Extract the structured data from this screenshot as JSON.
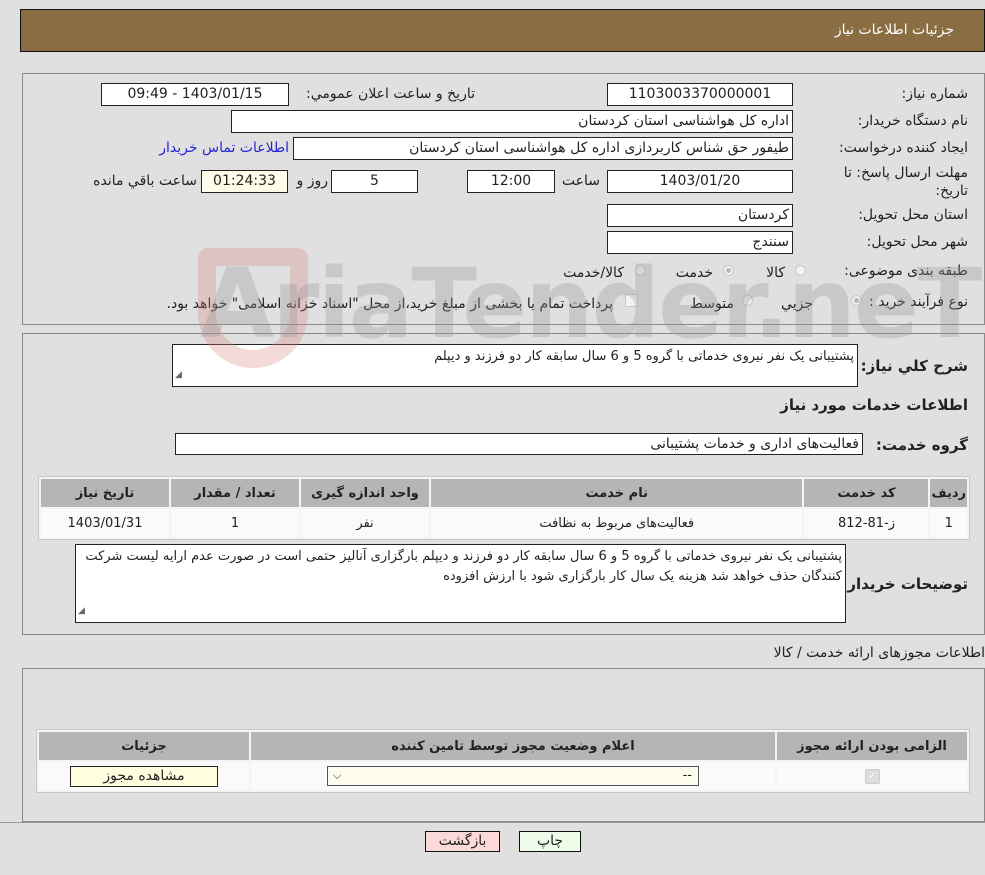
{
  "header": {
    "title": "جزئیات اطلاعات نیاز"
  },
  "info": {
    "need_number_label": "شماره نیاز:",
    "need_number": "1103003370000001",
    "announce_label": "تاریخ و ساعت اعلان عمومي:",
    "announce_value": "1403/01/15 - 09:49",
    "buyer_org_label": "نام دستگاه خریدار:",
    "buyer_org": "اداره کل هواشناسی استان کردستان",
    "creator_label": "ایجاد کننده درخواست:",
    "creator": "طیفور حق شناس کاربردازی اداره کل هواشناسی استان کردستان",
    "contact_link": "اطلاعات تماس خریدار",
    "deadline_label": "مهلت ارسال پاسخ: تا تاریخ:",
    "deadline_date": "1403/01/20",
    "time_label": "ساعت",
    "deadline_time": "12:00",
    "days": "5",
    "days_label": "روز و",
    "remaining": "01:24:33",
    "remaining_label": "ساعت باقي مانده",
    "province_label": "استان محل تحویل:",
    "province": "کردستان",
    "city_label": "شهر محل تحویل:",
    "city": "سنندج",
    "category_label": "طبقه بندی موضوعی:",
    "category_options": [
      "کالا",
      "خدمت",
      "کالا/خدمت"
    ],
    "category_selected": "خدمت",
    "process_label": "نوع فرآیند خرید :",
    "process_options": [
      "جزيي",
      "متوسط"
    ],
    "process_selected": "جزيي",
    "treasury_note": "پرداخت تمام یا بخشی از مبلغ خرید،از محل \"اسناد خزانه اسلامی\" خواهد بود."
  },
  "description": {
    "label": "شرح کلي نیاز:",
    "text": "پشتیبانی یک نفر نیروی خدماتی با گروه 5 و 6 سال سابقه کار دو فرزند و دیپلم"
  },
  "services": {
    "section_title": "اطلاعات خدمات مورد نیاز",
    "group_label": "گروه خدمت:",
    "group_value": "فعالیت‌های اداری و خدمات پشتیبانی",
    "columns": [
      "ردیف",
      "کد خدمت",
      "نام خدمت",
      "واحد اندازه گیری",
      "تعداد / مقدار",
      "تاریخ نیاز"
    ],
    "rows": [
      [
        "1",
        "ز-81-812",
        "فعالیت‌های مربوط به نظافت",
        "نفر",
        "1",
        "1403/01/31"
      ]
    ]
  },
  "buyer_notes": {
    "label": "توضیحات خریدار:",
    "text": "پشتیبانی یک نفر نیروی خدماتی با گروه 5 و 6 سال سابقه کار دو فرزند و دیپلم بارگزاری آنالیز حتمی است در صورت عدم ارایه لیست شرکت کنندگان حذف خواهد شد هزینه یک سال کار بارگزاری شود با ارزش افزوده"
  },
  "permits": {
    "section_title": "اطلاعات مجوزهای ارائه خدمت / کالا",
    "columns": [
      "الزامی بودن ارائه مجوز",
      "اعلام وضعیت مجوز توسط تامین کننده",
      "جزئیات"
    ],
    "select_value": "--",
    "view_button": "مشاهده مجوز"
  },
  "footer": {
    "print_button": "چاپ",
    "back_button": "بازگشت"
  },
  "watermark": "AriaTender.neT"
}
